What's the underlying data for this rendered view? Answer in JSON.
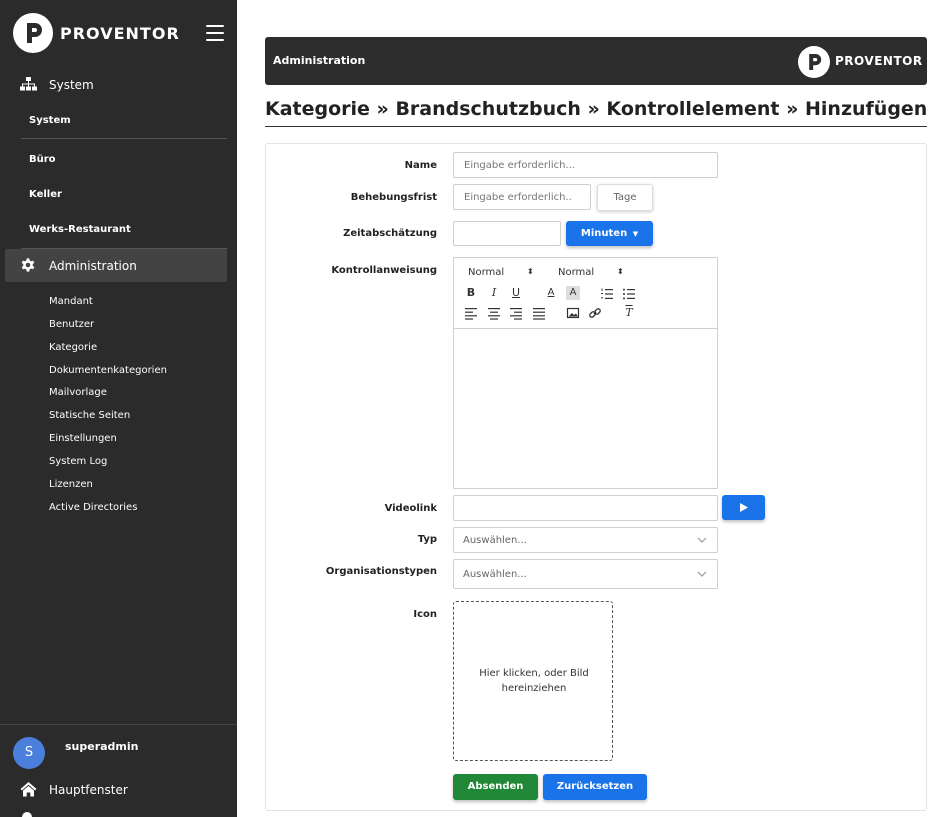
{
  "sidebar": {
    "brand": "PROVENTOR",
    "nav_system": "System",
    "sites": [
      "System",
      "Büro",
      "Keller",
      "Werks-Restaurant"
    ],
    "nav_admin": "Administration",
    "admin_items": [
      "Mandant",
      "Benutzer",
      "Kategorie",
      "Dokumentenkategorien",
      "Mailvorlage",
      "Statische Seiten",
      "Einstellungen",
      "System Log",
      "Lizenzen",
      "Active Directories"
    ],
    "user": {
      "initial": "S",
      "name": "superadmin"
    },
    "home": "Hauptfenster"
  },
  "header": {
    "title": "Administration",
    "brand": "PROVENTOR"
  },
  "page": {
    "title": "Kategorie » Brandschutzbuch » Kontrollelement » Hinzufügen"
  },
  "form": {
    "name": {
      "label": "Name",
      "placeholder": "Eingabe erforderlich..."
    },
    "behebungsfrist": {
      "label": "Behebungsfrist",
      "placeholder": "Eingabe erforderlich..",
      "addon": "Tage"
    },
    "zeitabschaetzung": {
      "label": "Zeitabschätzung",
      "unit_button": "Minuten"
    },
    "kontrollanweisung": {
      "label": "Kontrollanweisung",
      "format_1": "Normal",
      "format_2": "Normal"
    },
    "videolink": {
      "label": "Videolink",
      "play_icon": "play-icon"
    },
    "typ": {
      "label": "Typ",
      "placeholder": "Auswählen..."
    },
    "organisationstypen": {
      "label": "Organisationstypen",
      "placeholder": "Auswählen..."
    },
    "icon": {
      "label": "Icon",
      "dropzone_text": "Hier klicken, oder Bild hereinziehen"
    },
    "submit": "Absenden",
    "reset": "Zurücksetzen"
  },
  "colors": {
    "sidebar_bg": "#2b2b2b",
    "accent_blue": "#1a73e8",
    "submit_green": "#218838",
    "avatar_blue": "#4a7fdc"
  }
}
